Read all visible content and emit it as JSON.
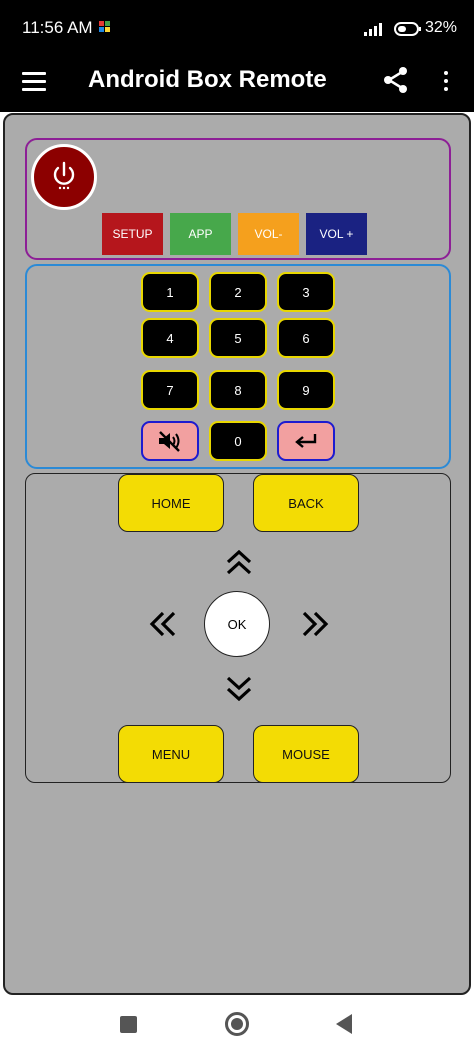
{
  "status_bar": {
    "time": "11:56 AM",
    "battery_pct": "32%"
  },
  "app_bar": {
    "title": "Android Box Remote"
  },
  "controls": {
    "setup": "SETUP",
    "app": "APP",
    "vol_down": "VOL-",
    "vol_up": "VOL +"
  },
  "control_colors": {
    "setup": "#b5161c",
    "app": "#47a84b",
    "vol_down": "#f5a01d",
    "vol_up": "#1a2282"
  },
  "numpad": {
    "k1": "1",
    "k2": "2",
    "k3": "3",
    "k4": "4",
    "k5": "5",
    "k6": "6",
    "k7": "7",
    "k8": "8",
    "k9": "9",
    "k0": "0"
  },
  "nav": {
    "home": "HOME",
    "back": "BACK",
    "ok": "OK",
    "menu": "MENU",
    "mouse": "MOUSE"
  },
  "icons": [
    "menu-icon",
    "share-icon",
    "more-vert-icon",
    "power-icon",
    "mute-icon",
    "enter-icon",
    "chevron-double-up-icon",
    "chevron-double-down-icon",
    "chevron-double-left-icon",
    "chevron-double-right-icon"
  ]
}
